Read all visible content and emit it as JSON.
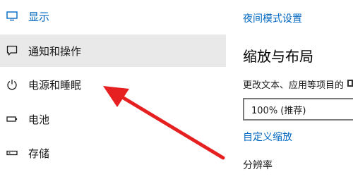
{
  "sidebar": {
    "items": [
      {
        "label": "显示",
        "icon": "display-icon",
        "active": true
      },
      {
        "label": "通知和操作",
        "icon": "notification-icon",
        "hover": true
      },
      {
        "label": "电源和睡眠",
        "icon": "power-icon"
      },
      {
        "label": "电池",
        "icon": "battery-icon"
      },
      {
        "label": "存储",
        "icon": "storage-icon"
      }
    ]
  },
  "content": {
    "night_mode_link": "夜间模式设置",
    "section_title": "缩放与布局",
    "scale_label": "更改文本、应用等项目的",
    "scale_select_value": "100% (推荐)",
    "custom_scale_link": "自定义缩放",
    "resolution_label": "分辨率"
  },
  "colors": {
    "accent": "#0067c0",
    "hover_bg": "#e9e9e9",
    "arrow": "#e62020"
  }
}
